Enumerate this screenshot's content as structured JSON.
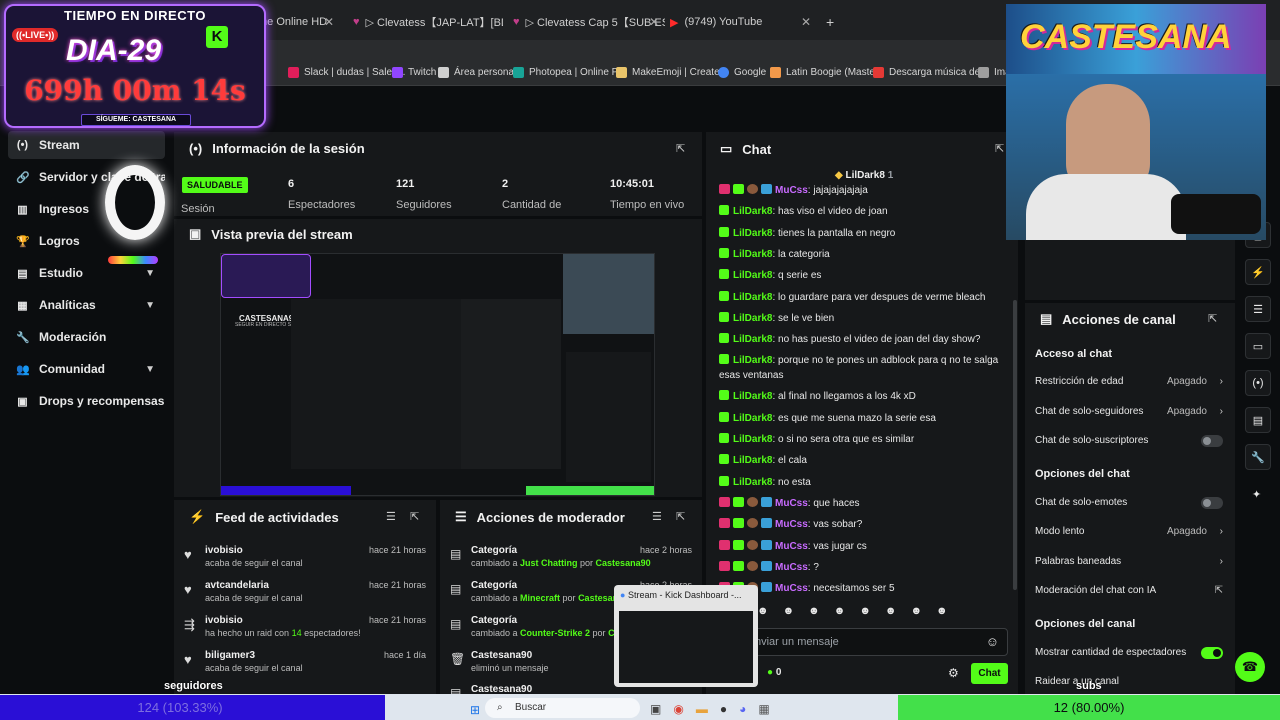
{
  "browser": {
    "tabs": [
      {
        "label": "me Online HD"
      },
      {
        "label": "▷ Clevatess【JAP-LAT】[BD] Ve"
      },
      {
        "label": "▷ Clevatess Cap 5【SUB ESPAÑ"
      },
      {
        "label": "(9749) YouTube"
      }
    ],
    "new_tab": "+",
    "bookmarks": [
      {
        "label": "Slack | dudas | Sales..."
      },
      {
        "label": "Twitch"
      },
      {
        "label": "Área personal"
      },
      {
        "label": "Photopea | Online P..."
      },
      {
        "label": "MakeEmoji | Create..."
      },
      {
        "label": "Google"
      },
      {
        "label": "Latin Boogie (Maste..."
      },
      {
        "label": "Descarga música de..."
      },
      {
        "label": "Ima"
      }
    ]
  },
  "overlay": {
    "timer_header": "TIEMPO EN DIRECTO",
    "live": "((•LIVE•))",
    "day": "DIA-29",
    "k": "K",
    "time": "699h 00m 14s",
    "follow": "SÍGUEME: CASTESANA",
    "webcam_logo": "CASTESANA"
  },
  "sidebar": {
    "items": [
      {
        "label": "Stream",
        "icon": "broadcast-icon"
      },
      {
        "label": "Servidor y clave de transmisión",
        "icon": "link-icon"
      },
      {
        "label": "Ingresos",
        "icon": "chart-icon"
      },
      {
        "label": "Logros",
        "icon": "trophy-icon"
      },
      {
        "label": "Estudio",
        "icon": "folder-icon"
      },
      {
        "label": "Analíticas",
        "icon": "analytics-icon"
      },
      {
        "label": "Moderación",
        "icon": "wrench-icon"
      },
      {
        "label": "Comunidad",
        "icon": "people-icon"
      },
      {
        "label": "Drops y recompensas",
        "icon": "gift-icon"
      }
    ]
  },
  "session": {
    "title": "Información de la sesión",
    "health": "SALUDABLE",
    "health_label": "Sesión",
    "stats": [
      {
        "value": "6",
        "label": "Espectadores"
      },
      {
        "value": "121",
        "label": "Seguidores"
      },
      {
        "value": "2",
        "label": "Cantidad de"
      },
      {
        "value": "10:45:01",
        "label": "Tiempo en vivo"
      }
    ]
  },
  "preview": {
    "title": "Vista previa del stream",
    "overlay_name": "CASTESANA90",
    "overlay_sub": "SEGUIR EN DIRECTO SIN CORTES"
  },
  "feed": {
    "title": "Feed de actividades",
    "rows": [
      {
        "name": "ivobisio",
        "desc": "acaba de seguir el canal",
        "time": "hace 21 horas",
        "icon": "heart-icon"
      },
      {
        "name": "avtcandelaria",
        "desc": "acaba de seguir el canal",
        "time": "hace 21 horas",
        "icon": "heart-icon"
      },
      {
        "name": "ivobisio",
        "desc_pre": "ha hecho un raid con ",
        "desc_num": "14",
        "desc_post": " espectadores!",
        "time": "hace 21 horas",
        "icon": "raid-icon"
      },
      {
        "name": "biligamer3",
        "desc": "acaba de seguir el canal",
        "time": "hace 1 día",
        "icon": "heart-icon"
      }
    ]
  },
  "modactions": {
    "title": "Acciones de moderador",
    "rows": [
      {
        "name": "Categoría",
        "pre": "cambiado a ",
        "cat": "Just Chatting",
        "mid": " por ",
        "by": "Castesana90",
        "time": "hace 2 horas"
      },
      {
        "name": "Categoría",
        "pre": "cambiado a ",
        "cat": "Minecraft",
        "mid": " por ",
        "by": "Castesana",
        "time": "hace 2 horas"
      },
      {
        "name": "Categoría",
        "pre": "cambiado a ",
        "cat": "Counter-Strike 2",
        "mid": " por ",
        "by": "Cas",
        "time": ""
      },
      {
        "name": "Castesana90",
        "desc": "eliminó un mensaje",
        "time": ""
      },
      {
        "name": "Castesana90",
        "desc": "",
        "time": ""
      }
    ]
  },
  "chat": {
    "title": "Chat",
    "pinned_user": "LilDark8",
    "pinned_count": "1",
    "messages": [
      {
        "user": "MuCss",
        "text": "jajajajajajaja",
        "color": "#c86bff",
        "type": "sub"
      },
      {
        "user": "LilDark8",
        "text": "has viso el video de joan",
        "color": "#53fc18",
        "type": "std"
      },
      {
        "user": "LilDark8",
        "text": "tienes la pantalla en negro",
        "color": "#53fc18",
        "type": "std"
      },
      {
        "user": "LilDark8",
        "text": "la categoria",
        "color": "#53fc18",
        "type": "std"
      },
      {
        "user": "LilDark8",
        "text": "q serie es",
        "color": "#53fc18",
        "type": "std"
      },
      {
        "user": "LilDark8",
        "text": "lo guardare para ver despues de verme bleach",
        "color": "#53fc18",
        "type": "std"
      },
      {
        "user": "LilDark8",
        "text": "se le ve bien",
        "color": "#53fc18",
        "type": "std"
      },
      {
        "user": "LilDark8",
        "text": "no has puesto el video de joan del day show?",
        "color": "#53fc18",
        "type": "std"
      },
      {
        "user": "LilDark8",
        "text": "porque no te pones un adblock para q no te salga esas ventanas",
        "color": "#53fc18",
        "type": "std"
      },
      {
        "user": "LilDark8",
        "text": "al final no llegamos a los 4k xD",
        "color": "#53fc18",
        "type": "std"
      },
      {
        "user": "LilDark8",
        "text": "es que me suena mazo la serie esa",
        "color": "#53fc18",
        "type": "std"
      },
      {
        "user": "LilDark8",
        "text": "o si no sera otra que es similar",
        "color": "#53fc18",
        "type": "std"
      },
      {
        "user": "LilDark8",
        "text": "el cala",
        "color": "#53fc18",
        "type": "std"
      },
      {
        "user": "LilDark8",
        "text": "no esta",
        "color": "#53fc18",
        "type": "std"
      },
      {
        "user": "MuCss",
        "text": "que haces",
        "color": "#c86bff",
        "type": "sub"
      },
      {
        "user": "MuCss",
        "text": "vas sobar?",
        "color": "#c86bff",
        "type": "sub"
      },
      {
        "user": "MuCss",
        "text": "vas jugar cs",
        "color": "#c86bff",
        "type": "sub"
      },
      {
        "user": "MuCss",
        "text": "?",
        "color": "#c86bff",
        "type": "sub"
      },
      {
        "user": "MuCss",
        "text": "necesitamos ser 5",
        "color": "#c86bff",
        "type": "sub"
      }
    ],
    "input_placeholder": "nviar un mensaje",
    "viewer_count": "0",
    "send": "Chat"
  },
  "channel_actions": {
    "title": "Acciones de canal",
    "sections": [
      {
        "heading": "Acceso al chat",
        "rows": [
          {
            "label": "Restricción de edad",
            "value": "Apagado",
            "kind": "chevron"
          },
          {
            "label": "Chat de solo-seguidores",
            "value": "Apagado",
            "kind": "chevron"
          },
          {
            "label": "Chat de solo-suscriptores",
            "value": "",
            "kind": "toggle-off"
          }
        ]
      },
      {
        "heading": "Opciones del chat",
        "rows": [
          {
            "label": "Chat de solo-emotes",
            "value": "",
            "kind": "toggle-off"
          },
          {
            "label": "Modo lento",
            "value": "Apagado",
            "kind": "chevron"
          },
          {
            "label": "Palabras baneadas",
            "value": "",
            "kind": "chevron"
          },
          {
            "label": "Moderación del chat con IA",
            "value": "",
            "kind": "external"
          }
        ]
      },
      {
        "heading": "Opciones del canal",
        "rows": [
          {
            "label": "Mostrar cantidad de espectadores",
            "value": "",
            "kind": "toggle-on"
          },
          {
            "label": "Raidear a un canal",
            "value": "",
            "kind": "none"
          }
        ]
      }
    ]
  },
  "thumbnail": {
    "title": "Stream - Kick Dashboard -..."
  },
  "goals": {
    "left_label": "seguidores",
    "left_value": "124 (103.33%)",
    "right_label": "subs",
    "right_value": "12 (80.00%)"
  },
  "taskbar": {
    "search": "Buscar"
  },
  "colors": {
    "kick_green": "#53fc18",
    "panel": "#16181a",
    "bg": "#0b0d0f",
    "sub_purple": "#c86bff",
    "goal_left": "#2a0fd6",
    "goal_right": "#43e04a"
  }
}
